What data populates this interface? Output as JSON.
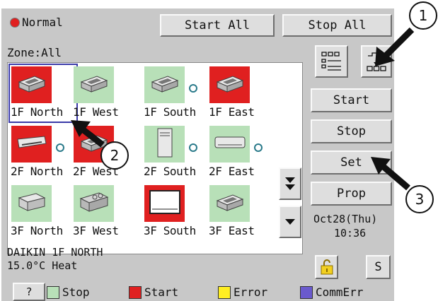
{
  "header": {
    "status_label": "Normal",
    "start_all_label": "Start All",
    "stop_all_label": "Stop All",
    "zone_label": "Zone:All"
  },
  "units": [
    {
      "label": "1F North",
      "status": "start",
      "icon": "ceiling-cassette-icon",
      "selected": true
    },
    {
      "label": "1F West",
      "status": "stop",
      "icon": "ceiling-cassette-icon"
    },
    {
      "label": "1F South",
      "status": "stop",
      "icon": "ceiling-cassette-icon",
      "dot": true
    },
    {
      "label": "1F East",
      "status": "start",
      "icon": "ceiling-cassette-icon"
    },
    {
      "label": "2F North",
      "status": "start",
      "icon": "ceiling-suspended-icon",
      "dot": true
    },
    {
      "label": "2F West",
      "status": "start",
      "icon": "ceiling-cassette-icon"
    },
    {
      "label": "2F South",
      "status": "stop",
      "icon": "floor-standing-icon",
      "dot": true
    },
    {
      "label": "2F East",
      "status": "stop",
      "icon": "wall-mounted-icon",
      "dot": true
    },
    {
      "label": "3F North",
      "status": "stop",
      "icon": "duct-unit-icon"
    },
    {
      "label": "3F West",
      "status": "stop",
      "icon": "ventilation-unit-icon"
    },
    {
      "label": "3F South",
      "status": "start",
      "icon": "floor-concealed-icon"
    },
    {
      "label": "3F East",
      "status": "stop",
      "icon": "ceiling-cassette-icon"
    }
  ],
  "info": {
    "line1": "DAIKIN 1F NORTH",
    "line2": "15.0°C  Heat"
  },
  "side": {
    "start_label": "Start",
    "stop_label": "Stop",
    "set_label": "Set",
    "prop_label": "Prop",
    "date": "Oct28(Thu)",
    "time": "10:36",
    "s_label": "S"
  },
  "footer": {
    "help_label": "?",
    "legend": [
      {
        "label": "Stop",
        "color": "#b8e0b8"
      },
      {
        "label": "Start",
        "color": "#e02020"
      },
      {
        "label": "Error",
        "color": "#ffee22"
      },
      {
        "label": "CommErr",
        "color": "#6a5acd"
      }
    ]
  },
  "callouts": [
    "1",
    "2",
    "3"
  ],
  "colors": {
    "stop": "#b8e0b8",
    "start": "#e02020",
    "selected_border": "#3a3aa8",
    "normal_dot": "#e02020",
    "lock": "#f2d020"
  }
}
